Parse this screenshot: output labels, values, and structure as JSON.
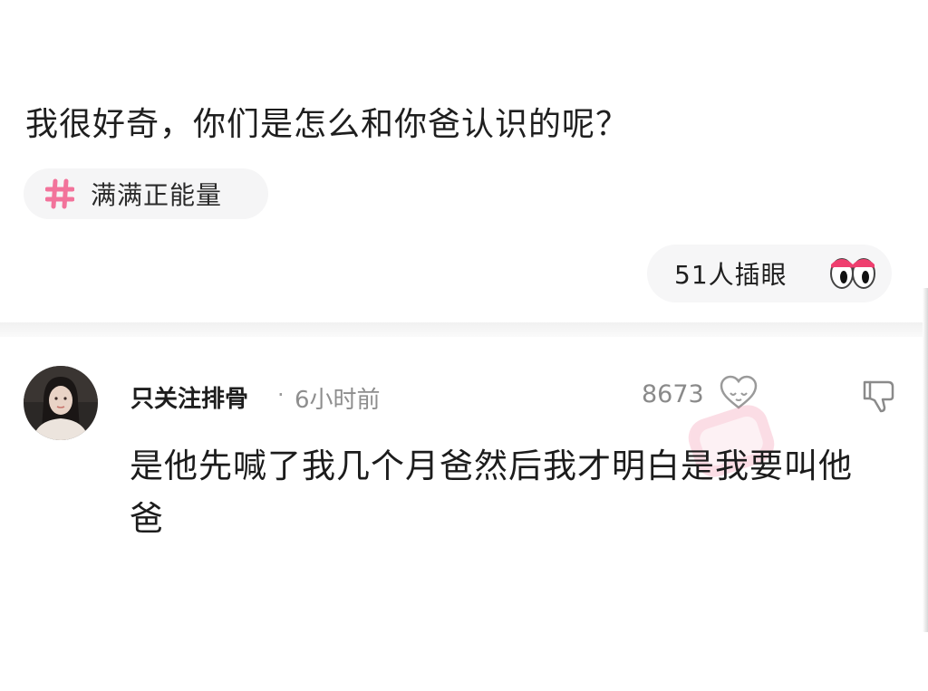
{
  "question": {
    "title": "我很好奇，你们是怎么和你爸认识的呢？"
  },
  "topic_tag": {
    "icon": "hash-icon",
    "label": "满满正能量",
    "accent_color": "#f2739b"
  },
  "watchers": {
    "label": "51人插眼",
    "icon": "eyes-icon"
  },
  "comment": {
    "username": "只关注排骨",
    "separator": "·",
    "timestamp": "6小时前",
    "like_count": "8673",
    "like_icon": "heart-outline-icon",
    "dislike_icon": "thumbs-down-icon",
    "body": "是他先喊了我几个月爸然后我才明白是我要叫他爸"
  }
}
